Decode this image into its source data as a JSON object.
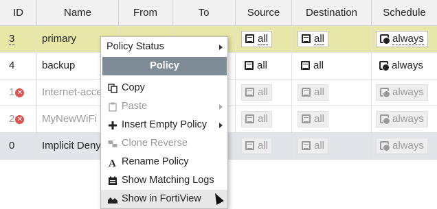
{
  "columns": [
    "ID",
    "Name",
    "From",
    "To",
    "Source",
    "Destination",
    "Schedule"
  ],
  "rows": [
    {
      "id": "3",
      "name": "primary",
      "source": "all",
      "destination": "all",
      "schedule": "always"
    },
    {
      "id": "4",
      "name": "backup",
      "source": "all",
      "destination": "all",
      "schedule": "always"
    },
    {
      "id": "1",
      "name": "Internet-acce",
      "source": "all",
      "destination": "all",
      "schedule": "always"
    },
    {
      "id": "2",
      "name": "MyNewWiFi",
      "source": "all",
      "destination": "all",
      "schedule": "always"
    },
    {
      "id": "0",
      "name": "Implicit Deny",
      "source": "all",
      "destination": "all",
      "schedule": "always"
    }
  ],
  "menu": {
    "policy_status": "Policy Status",
    "header": "Policy",
    "copy": "Copy",
    "paste": "Paste",
    "insert_empty_policy": "Insert Empty Policy",
    "clone_reverse": "Clone Reverse",
    "rename_policy": "Rename Policy",
    "show_matching_logs": "Show Matching Logs",
    "show_in_fortiview": "Show in FortiView"
  },
  "colors": {
    "selected_row": "#e7e7a8",
    "implicit_row": "#e1e4e8",
    "menu_header": "#7f8b96",
    "error": "#d9534f"
  }
}
